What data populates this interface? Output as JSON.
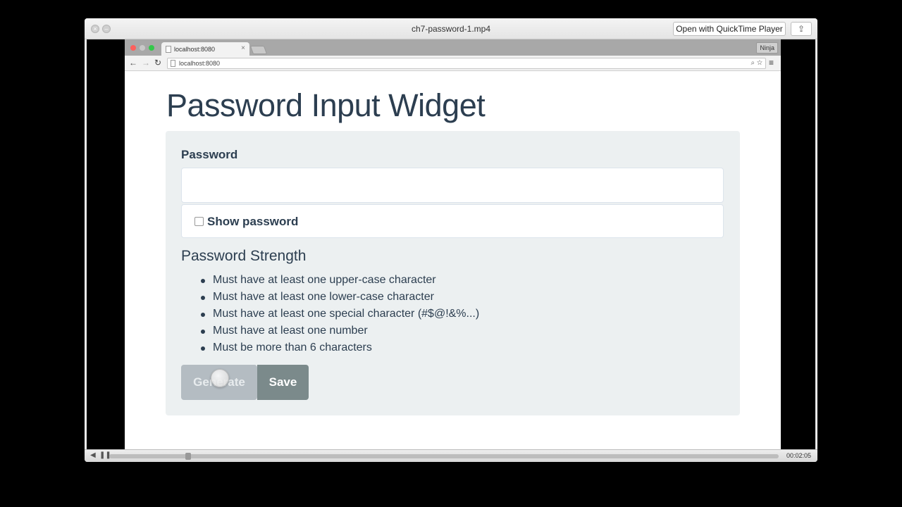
{
  "player": {
    "title": "ch7-password-1.mp4",
    "open_with_label": "Open with QuickTime Player",
    "share_icon": "share-icon",
    "time": "00:02:05",
    "progress": 0.115
  },
  "browser": {
    "tab_label": "localhost:8080",
    "tab_close": "×",
    "profile_label": "Ninja",
    "url": "localhost:8080"
  },
  "page": {
    "title": "Password Input Widget",
    "password_label": "Password",
    "password_value": "",
    "show_password_label": "Show password",
    "strength_heading": "Password Strength",
    "rules": [
      "Must have at least one upper-case character",
      "Must have at least one lower-case character",
      "Must have at least one special character (#$@!&%...)",
      "Must have at least one number",
      "Must be more than 6 characters"
    ],
    "generate_label": "Generate",
    "save_label": "Save"
  },
  "colors": {
    "heading": "#2c3e50",
    "panel": "#ecf0f1",
    "generate_button": "#b4bcc2",
    "save_button": "#7b8a8b"
  }
}
